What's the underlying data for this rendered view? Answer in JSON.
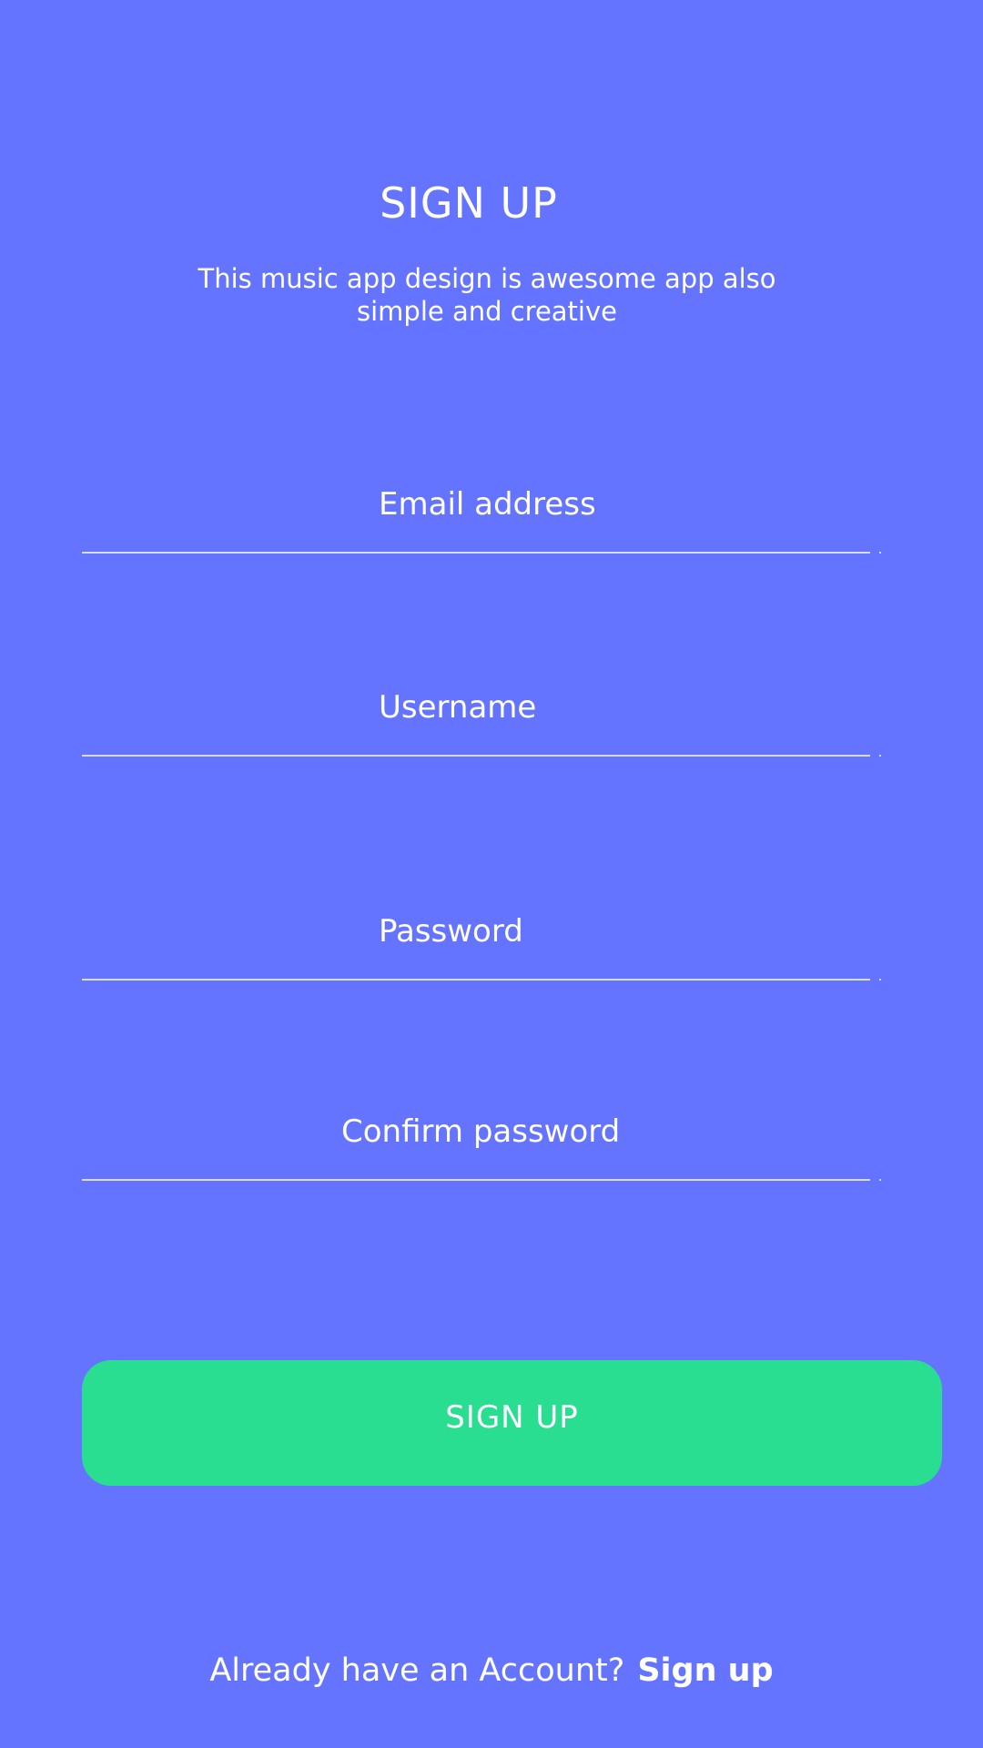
{
  "header": {
    "title": "SIGN UP",
    "subtitle": "This music app design is awesome app also simple and creative"
  },
  "form": {
    "email": {
      "value": "",
      "placeholder": "Email address"
    },
    "username": {
      "value": "",
      "placeholder": "Username"
    },
    "password": {
      "value": "",
      "placeholder": "Password"
    },
    "confirm_password": {
      "value": "",
      "placeholder": "Confirm password"
    },
    "submit_label": "SIGN UP"
  },
  "footer": {
    "prompt": "Already have an Account?",
    "link_label": "Sign up"
  },
  "colors": {
    "background": "#6474FF",
    "button": "#29DE91",
    "text": "#FFFFFF"
  }
}
